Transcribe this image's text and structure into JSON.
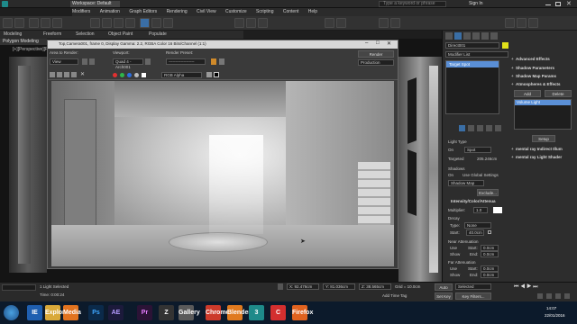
{
  "title_bar": {
    "workspace": "Workspace: Default",
    "search_placeholder": "Type a keyword or phrase",
    "sign_in": "Sign In"
  },
  "menu": [
    "Modifiers",
    "Animation",
    "Graph Editors",
    "Rendering",
    "Civil View",
    "Customize",
    "Scripting",
    "Content",
    "Help"
  ],
  "ribbon": {
    "tabs": [
      "Modeling",
      "Freeform",
      "Selection",
      "Object Paint",
      "Populate"
    ],
    "sub_label": "Polygon Modeling"
  },
  "viewport": {
    "label": "[+][Perspective][Realistic]"
  },
  "render_window": {
    "title": "Top,Camera001, frame 0, Display Gamma: 2.2, RGBA Color 16 Bits/Channel (1:1)",
    "area_to_render_label": "Area to Render:",
    "area_to_render_value": "View",
    "viewport_label": "Viewport:",
    "viewport_value": "Quad 4 - Arch001",
    "preset_label": "Render Preset:",
    "preset_value": "-------------------",
    "render_button": "Render",
    "production_value": "Production",
    "channel_value": "RGB Alpha"
  },
  "right_panel": {
    "object_name": "Direct001",
    "modifier_list": "Modifier List",
    "stack_item": "Target Spot",
    "sections": [
      "Advanced Effects",
      "Shadow Parameters",
      "Shadow Map Params",
      "Atmospheres & Effects"
    ],
    "add_button": "Add",
    "delete_button": "Delete",
    "volume_light": "Volume Light",
    "setup_button": "Setup",
    "mental_indirect": "mental ray Indirect Illum",
    "mental_light_shader": "mental ray Light Shader",
    "light_type_label": "Light Type",
    "light_on": "On",
    "light_type_value": "Spot",
    "targeted_label": "Targeted",
    "targeted_value": "205.246cm",
    "shadows_label": "Shadows",
    "shadows_on": "On",
    "use_global": "Use Global Settings",
    "shadow_map": "Shadow Map",
    "exclude_button": "Exclude...",
    "intensity_header": "Intensity/Color/Attenua",
    "multiplier_label": "Multiplier:",
    "multiplier_value": "1.0",
    "decay_label": "Decay",
    "decay_type_label": "Type:",
    "decay_type_value": "None",
    "decay_start_label": "Start:",
    "decay_start_value": "40.0cm",
    "near_atten_label": "Near Attenuation",
    "near_use": "Use",
    "near_show": "Show",
    "near_start_label": "Start:",
    "near_start_value": "0.0cm",
    "near_end_label": "End:",
    "near_end_value": "0.0cm",
    "far_atten_label": "Far Attenuation",
    "far_use": "Use",
    "far_show": "Show",
    "far_start_label": "Start:",
    "far_start_value": "0.0cm",
    "far_end_label": "End:",
    "far_end_value": "0.0cm",
    "spotlight_header": "Spotlight Parameters"
  },
  "status": {
    "selection": "1 Light Selected",
    "time": "Time: 0:00:24",
    "x_value": "X: 92.476cm",
    "y_value": "Y: 81.036cm",
    "z_value": "Z: 38.565cm",
    "grid_value": "Grid = 10.0cm",
    "add_time_tag": "Add Time Tag",
    "auto_key": "Auto Key",
    "selected_value": "Selected",
    "set_key": "Set Key",
    "key_filters": "Key Filters..."
  },
  "taskbar": {
    "apps": [
      "IE",
      "Explorer",
      "Media",
      "Ps",
      "AE",
      "Pr",
      "Z",
      "Gallery",
      "Chrome",
      "Blender",
      "3",
      "C",
      "Firefox"
    ],
    "clock": "14:07",
    "date": "22/01/2016"
  },
  "colors": {
    "accent": "#3a6ea5",
    "selection": "#5a8fd6",
    "ae": "#1c1a3b",
    "ps": "#0b2a4a",
    "pr": "#2b1336"
  }
}
